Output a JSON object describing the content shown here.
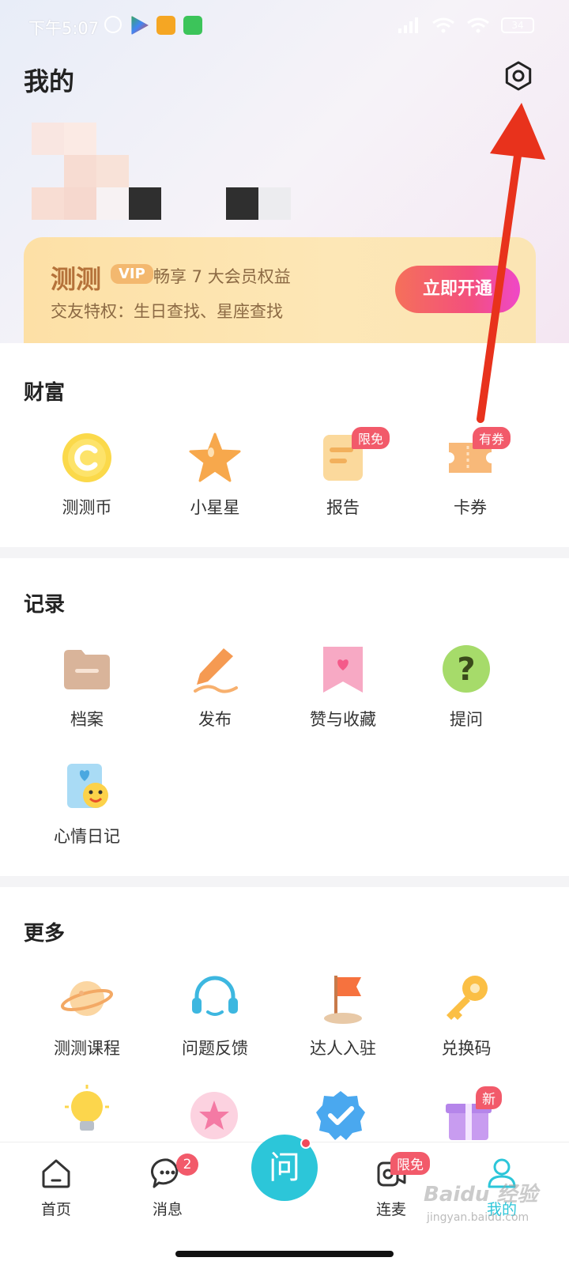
{
  "status_bar": {
    "time": "下午5:07",
    "battery": "34"
  },
  "header": {
    "title": "我的"
  },
  "vip": {
    "brand": "测测",
    "badge": "VIP",
    "description": "畅享 7 大会员权益",
    "subtitle": "交友特权：生日查找、星座查找",
    "button": "立即开通"
  },
  "wealth": {
    "title": "财富",
    "items": [
      {
        "label": "测测币",
        "icon": "coin-icon"
      },
      {
        "label": "小星星",
        "icon": "star-icon"
      },
      {
        "label": "报告",
        "icon": "report-icon",
        "badge": "限免"
      },
      {
        "label": "卡券",
        "icon": "ticket-icon",
        "badge": "有券"
      }
    ]
  },
  "records": {
    "title": "记录",
    "items": [
      {
        "label": "档案",
        "icon": "folder-icon"
      },
      {
        "label": "发布",
        "icon": "pen-icon"
      },
      {
        "label": "赞与收藏",
        "icon": "bookmark-heart-icon"
      },
      {
        "label": "提问",
        "icon": "question-icon"
      },
      {
        "label": "心情日记",
        "icon": "diary-icon"
      }
    ]
  },
  "more": {
    "title": "更多",
    "items": [
      {
        "label": "测测课程",
        "icon": "planet-icon"
      },
      {
        "label": "问题反馈",
        "icon": "headset-icon"
      },
      {
        "label": "达人入驻",
        "icon": "flag-icon"
      },
      {
        "label": "兑换码",
        "icon": "key-icon"
      }
    ],
    "row2_badge": "新"
  },
  "bottom_nav": {
    "items": [
      {
        "label": "首页",
        "icon": "home-icon"
      },
      {
        "label": "消息",
        "icon": "chat-icon",
        "badge": "2"
      },
      {
        "label": "连麦",
        "icon": "mic-icon",
        "badge": "限免"
      },
      {
        "label": "我的",
        "icon": "profile-icon"
      }
    ],
    "center_label": "问"
  },
  "watermark": {
    "brand": "Baidu 经验",
    "sub": "jingyan.baidu.com"
  },
  "colors": {
    "accent": "#2cc6d9",
    "badge": "#f25a6a",
    "vip_button": "#f34f7e",
    "arrow": "#e8321c"
  }
}
